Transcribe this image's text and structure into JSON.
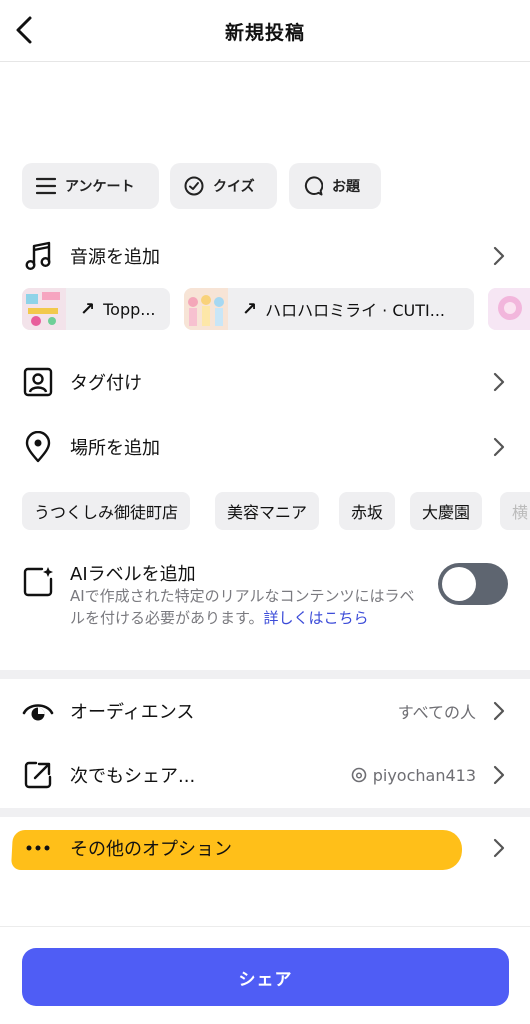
{
  "header": {
    "title": "新規投稿"
  },
  "attach": [
    {
      "label": "アンケート",
      "icon": "list-icon"
    },
    {
      "label": "クイズ",
      "icon": "check-circle-icon"
    },
    {
      "label": "お題",
      "icon": "speech-bubble-icon"
    }
  ],
  "music": {
    "label": "音源を追加",
    "tracks": [
      {
        "title": "Topp..."
      },
      {
        "title": "ハロハロミライ · CUTI..."
      }
    ]
  },
  "tag": {
    "label": "タグ付け"
  },
  "location": {
    "label": "場所を追加",
    "suggestions": [
      "うつくしみ御徒町店",
      "美容マニア",
      "赤坂",
      "大慶園",
      "横"
    ]
  },
  "ai_label": {
    "title": "AIラベルを追加",
    "description": "AIで作成された特定のリアルなコンテンツにはラベルを付ける必要があります。",
    "link": "詳しくはこちら",
    "enabled": false
  },
  "audience": {
    "label": "オーディエンス",
    "value": "すべての人"
  },
  "share_to": {
    "label": "次でもシェア...",
    "value": "piyochan413"
  },
  "more_options": {
    "label": "その他のオプション"
  },
  "share_button": {
    "label": "シェア"
  },
  "colors": {
    "accent": "#4f5df5",
    "highlight": "#ffb800",
    "toggle_off": "#5e6570"
  }
}
